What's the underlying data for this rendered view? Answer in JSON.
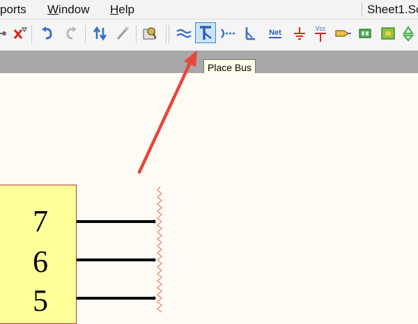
{
  "menubar": {
    "items": [
      "ports",
      "Window",
      "Help"
    ],
    "document_tab": "Sheet1.Sc"
  },
  "toolbar": {
    "active_tool": "place-bus",
    "net_label": "Net",
    "vcc_label": "Vcc"
  },
  "tooltip": {
    "text": "Place Bus"
  },
  "schematic": {
    "pin_numbers": [
      "7",
      "6",
      "5"
    ],
    "component_fill": "#ffff99",
    "component_border": "#b33a2e",
    "arrow_color": "#e8453c"
  }
}
